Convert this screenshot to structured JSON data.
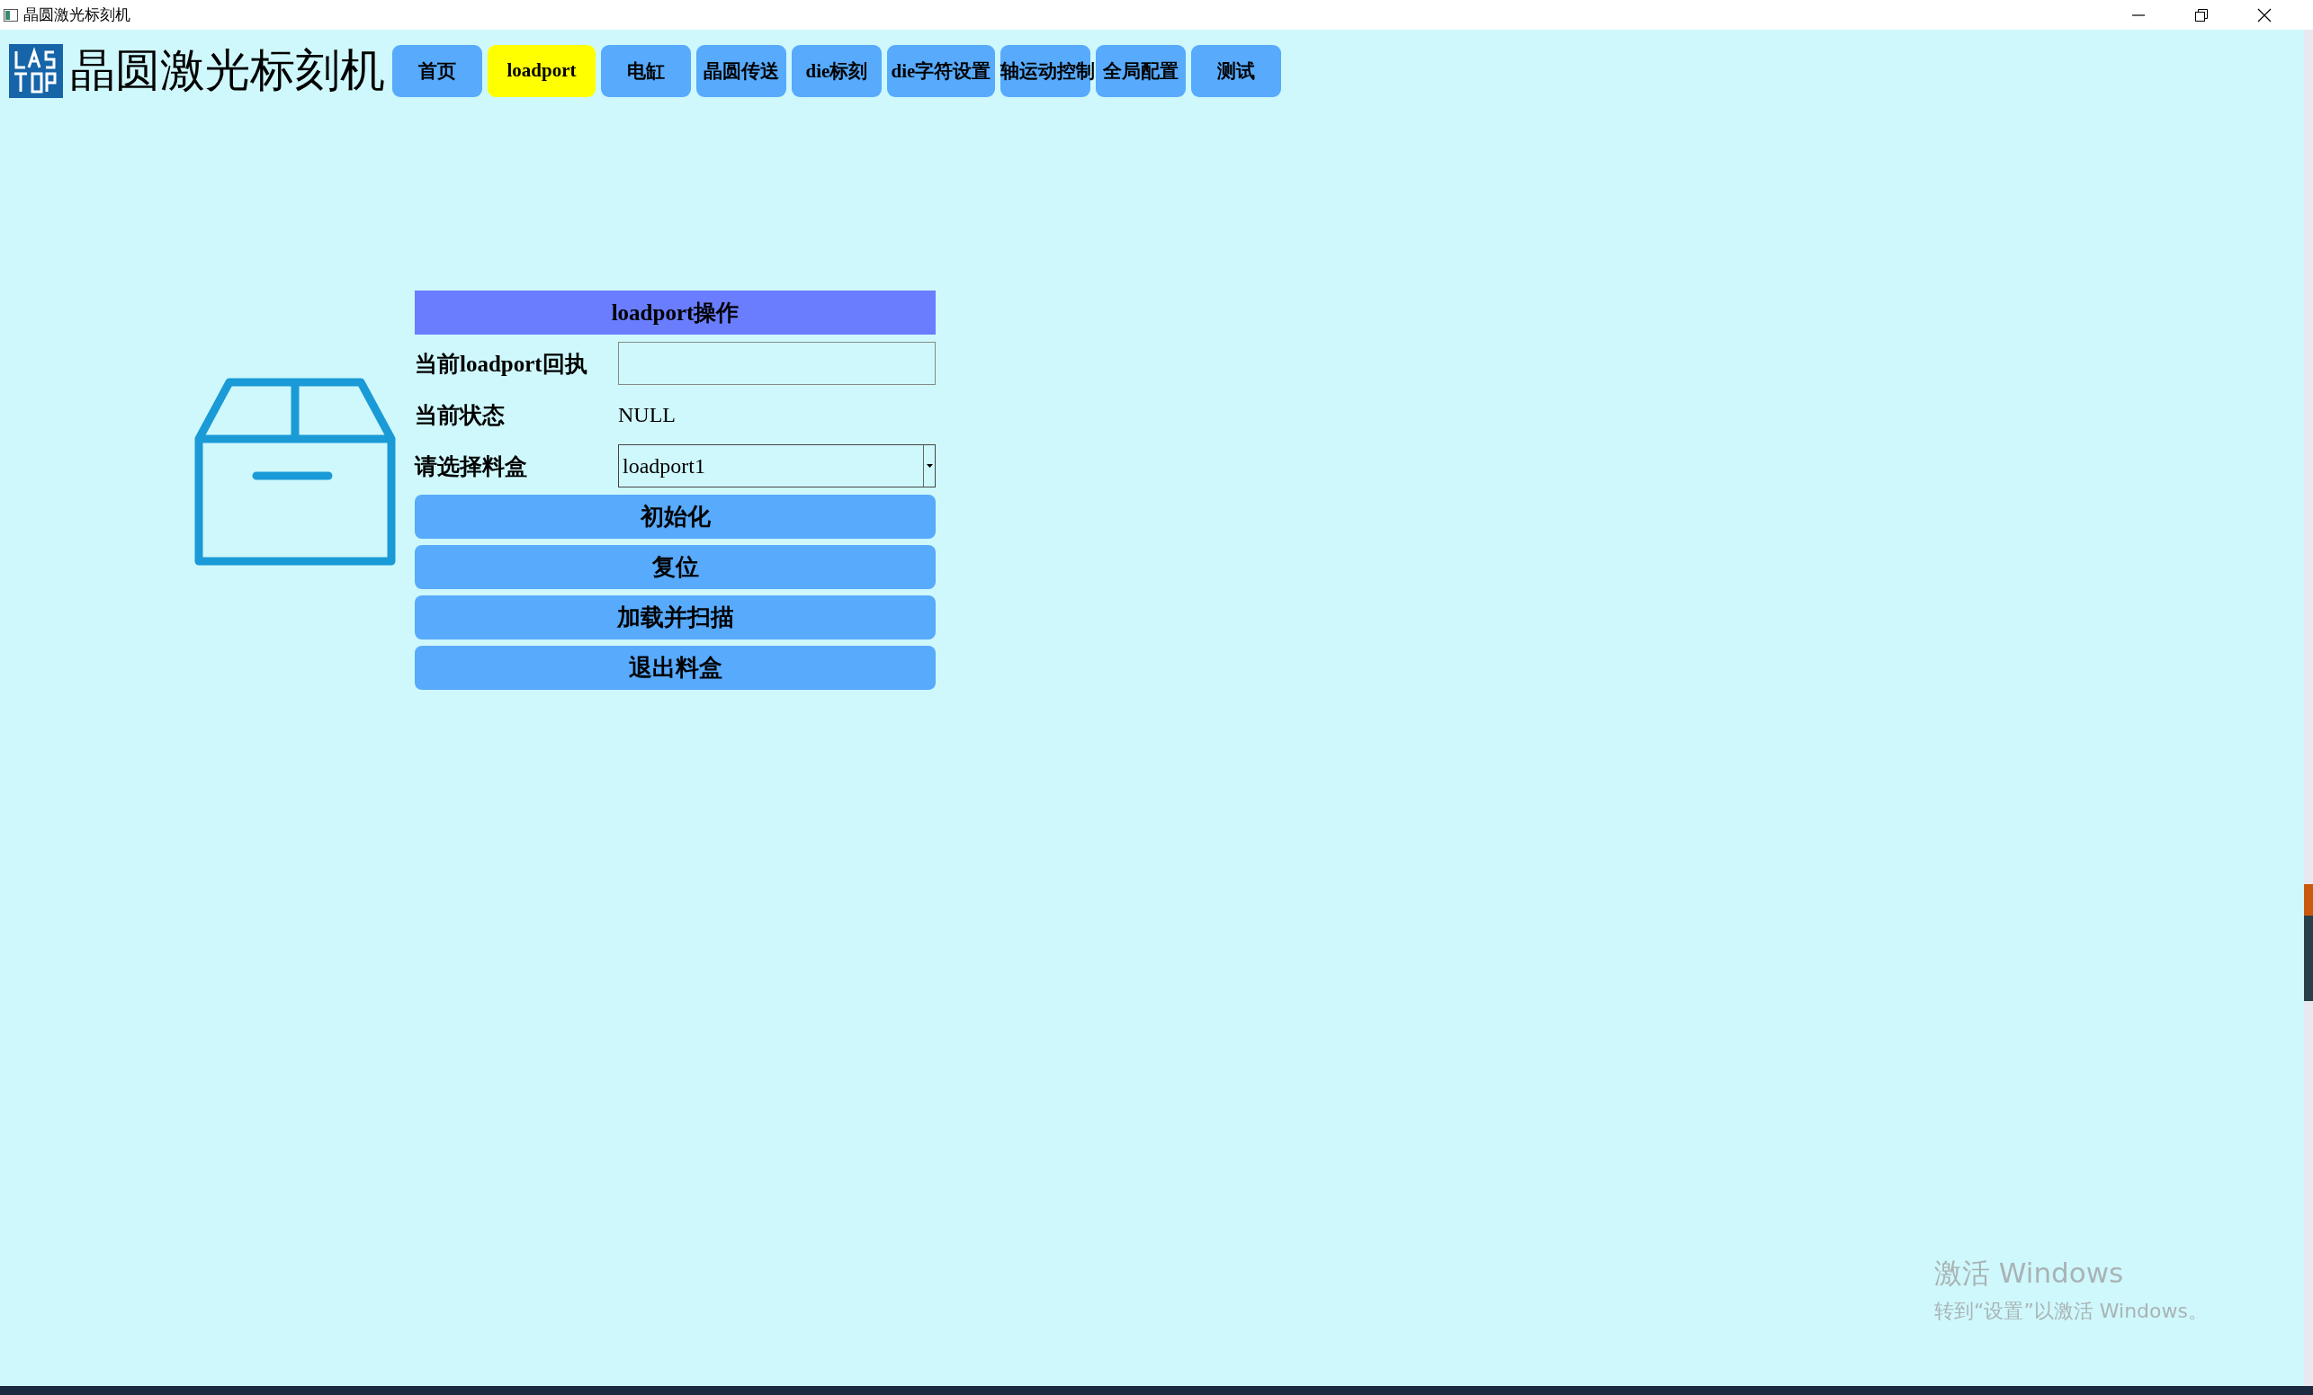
{
  "window": {
    "title": "晶圆激光标刻机"
  },
  "app_title": "晶圆激光标刻机",
  "tabs": [
    {
      "label": "首页",
      "selected": false
    },
    {
      "label": "loadport",
      "selected": true
    },
    {
      "label": "电缸",
      "selected": false
    },
    {
      "label": "晶圆传送",
      "selected": false
    },
    {
      "label": "die标刻",
      "selected": false
    },
    {
      "label": "die字符设置",
      "selected": false
    },
    {
      "label": "轴运动控制",
      "selected": false
    },
    {
      "label": "全局配置",
      "selected": false
    },
    {
      "label": "测试",
      "selected": false
    }
  ],
  "panel": {
    "title": "loadport操作",
    "receipt": {
      "label": "当前loadport回执"
    },
    "status": {
      "label": "当前状态",
      "value": "NULL"
    },
    "cassette": {
      "label": "请选择料盒",
      "value": "loadport1"
    },
    "buttons": [
      "初始化",
      "复位",
      "加载并扫描",
      "退出料盒"
    ]
  },
  "activation": {
    "title": "激活 Windows",
    "hint": "转到“设置”以激活 Windows。"
  }
}
